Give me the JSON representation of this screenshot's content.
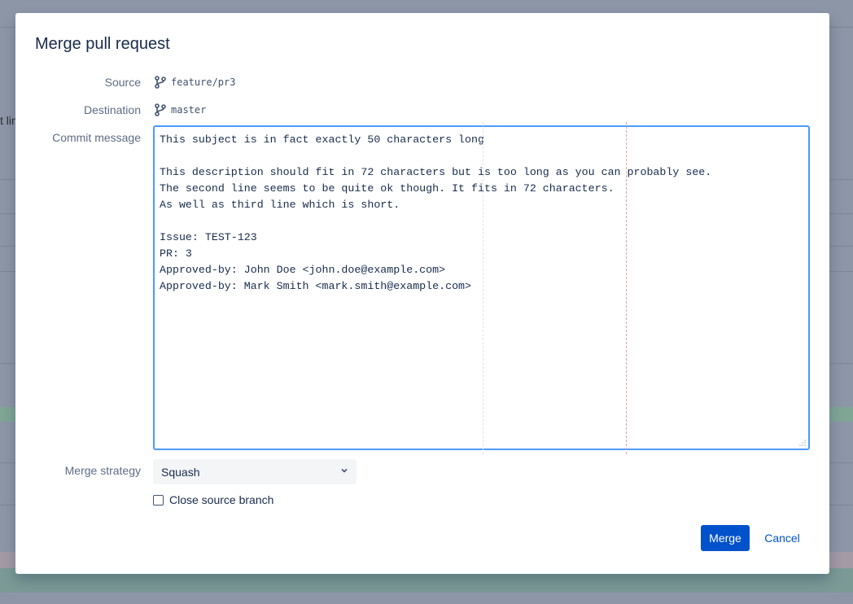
{
  "background": {
    "fragment_text": "t lin"
  },
  "dialog": {
    "title": "Merge pull request",
    "source": {
      "label": "Source",
      "branch": "feature/pr3",
      "icon": "branch-icon"
    },
    "destination": {
      "label": "Destination",
      "branch": "master",
      "icon": "branch-icon"
    },
    "commit": {
      "label": "Commit message",
      "value": "This subject is in fact exactly 50 characters long\n\nThis description should fit in 72 characters but is too long as you can probably see.\nThe second line seems to be quite ok though. It fits in 72 characters.\nAs well as third line which is short.\n\nIssue: TEST-123\nPR: 3\nApproved-by: John Doe <john.doe@example.com>\nApproved-by: Mark Smith <mark.smith@example.com>"
    },
    "strategy": {
      "label": "Merge strategy",
      "selected": "Squash"
    },
    "close_branch": {
      "label": "Close source branch",
      "checked": false
    },
    "actions": {
      "merge": "Merge",
      "cancel": "Cancel"
    }
  },
  "colors": {
    "primary": "#0052cc",
    "focus_border": "#4c9aff",
    "guide_72": "#e8a1a1",
    "overlay": "#8d96a7"
  }
}
